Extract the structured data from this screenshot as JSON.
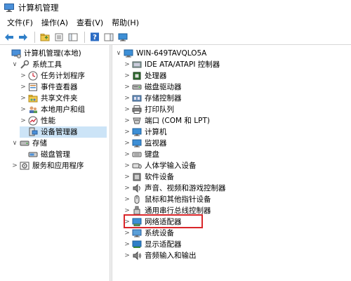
{
  "window": {
    "title": "计算机管理"
  },
  "menu": [
    "文件(F)",
    "操作(A)",
    "查看(V)",
    "帮助(H)"
  ],
  "toolbar": [
    "back-arrow-icon",
    "forward-arrow-icon",
    "up-folder-icon",
    "properties-icon",
    "show-hide-tree-icon",
    "help-icon",
    "action-pane-icon",
    "monitor-icon"
  ],
  "left_tree": [
    {
      "label": "计算机管理(本地)",
      "icon": "computer-management-icon",
      "indent": 0,
      "chevron": ""
    },
    {
      "label": "系统工具",
      "icon": "tools-icon",
      "indent": 1,
      "chevron": "∨"
    },
    {
      "label": "任务计划程序",
      "icon": "task-scheduler-icon",
      "indent": 2,
      "chevron": ">"
    },
    {
      "label": "事件查看器",
      "icon": "event-viewer-icon",
      "indent": 2,
      "chevron": ">"
    },
    {
      "label": "共享文件夹",
      "icon": "shared-folder-icon",
      "indent": 2,
      "chevron": ">"
    },
    {
      "label": "本地用户和组",
      "icon": "users-icon",
      "indent": 2,
      "chevron": ">"
    },
    {
      "label": "性能",
      "icon": "performance-icon",
      "indent": 2,
      "chevron": ">"
    },
    {
      "label": "设备管理器",
      "icon": "device-manager-icon",
      "indent": 2,
      "chevron": "",
      "selected": true
    },
    {
      "label": "存储",
      "icon": "storage-icon",
      "indent": 1,
      "chevron": "∨"
    },
    {
      "label": "磁盘管理",
      "icon": "disk-management-icon",
      "indent": 2,
      "chevron": ""
    },
    {
      "label": "服务和应用程序",
      "icon": "services-icon",
      "indent": 1,
      "chevron": ">"
    }
  ],
  "device_tree": {
    "root": {
      "label": "WIN-649TAVQLO5A",
      "icon": "computer-icon"
    },
    "items": [
      {
        "label": "IDE ATA/ATAPI 控制器",
        "icon": "ide-controller-icon"
      },
      {
        "label": "处理器",
        "icon": "processor-icon"
      },
      {
        "label": "磁盘驱动器",
        "icon": "disk-drive-icon"
      },
      {
        "label": "存储控制器",
        "icon": "storage-controller-icon"
      },
      {
        "label": "打印队列",
        "icon": "printer-icon"
      },
      {
        "label": "端口 (COM 和 LPT)",
        "icon": "port-icon"
      },
      {
        "label": "计算机",
        "icon": "computer-icon"
      },
      {
        "label": "监视器",
        "icon": "monitor-icon"
      },
      {
        "label": "键盘",
        "icon": "keyboard-icon"
      },
      {
        "label": "人体学输入设备",
        "icon": "hid-icon"
      },
      {
        "label": "软件设备",
        "icon": "software-device-icon"
      },
      {
        "label": "声音、视频和游戏控制器",
        "icon": "sound-icon"
      },
      {
        "label": "鼠标和其他指针设备",
        "icon": "mouse-icon"
      },
      {
        "label": "通用串行总线控制器",
        "icon": "usb-icon"
      },
      {
        "label": "网络适配器",
        "icon": "network-adapter-icon",
        "highlighted": true
      },
      {
        "label": "系统设备",
        "icon": "system-device-icon"
      },
      {
        "label": "显示适配器",
        "icon": "display-adapter-icon"
      },
      {
        "label": "音频输入和输出",
        "icon": "audio-io-icon"
      }
    ]
  },
  "colors": {
    "highlight_border": "#d9262a",
    "selection": "#cce4f7"
  }
}
